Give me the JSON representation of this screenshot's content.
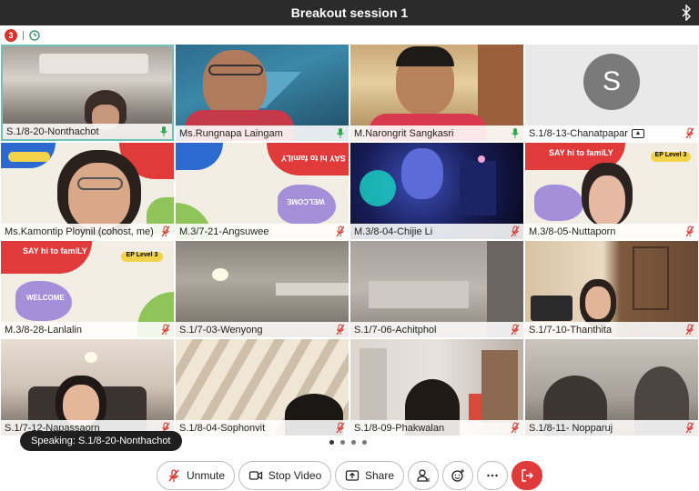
{
  "title": "Breakout session 1",
  "status": {
    "badge_count": "3"
  },
  "participants": [
    {
      "name": "S.1/8-20-Nonthachot",
      "mic": "on"
    },
    {
      "name": "Ms.Rungnapa Laingam",
      "mic": "on"
    },
    {
      "name": "M.Narongrit Sangkasri",
      "mic": "on"
    },
    {
      "name": "S.1/8-13-Chanatpapar",
      "mic": "muted",
      "sharing": true,
      "avatar_letter": "S"
    },
    {
      "name": "Ms.Kamontip Ploynil (cohost, me)",
      "mic": "muted"
    },
    {
      "name": "M.3/7-21-Angsuwee",
      "mic": "muted"
    },
    {
      "name": "M.3/8-04-Chijie Li",
      "mic": "muted"
    },
    {
      "name": "M.3/8-05-Nuttaporn",
      "mic": "muted"
    },
    {
      "name": "M.3/8-28-Lanlalin",
      "mic": "muted"
    },
    {
      "name": "S.1/7-03-Wenyong",
      "mic": "muted"
    },
    {
      "name": "S.1/7-06-Achitphol",
      "mic": "muted"
    },
    {
      "name": "S.1/7-10-Thanthita",
      "mic": "muted"
    },
    {
      "name": "S.1/7-12-Napassaorn",
      "mic": "muted"
    },
    {
      "name": "S.1/8-04-Sophonvit",
      "mic": "muted"
    },
    {
      "name": "S.1/8-09-Phakwalan",
      "mic": "muted"
    },
    {
      "name": "S.1/8-11- Nopparuj",
      "mic": "muted"
    }
  ],
  "backgrounds": {
    "slide_text": "SAY hi to famiLY",
    "slide_tag": "EP Level 3",
    "slide_welcome": "WELCOME"
  },
  "speaking": "Speaking: S.1/8-20-Nonthachot",
  "pagination": {
    "pages": 4,
    "current": 1
  },
  "toolbar": {
    "unmute": "Unmute",
    "stop_video": "Stop Video",
    "share": "Share"
  },
  "colors": {
    "active_border": "#6cc5b8",
    "leave": "#e03a3a",
    "muted_mic": "#d9342b",
    "live_mic": "#2fa84f"
  }
}
